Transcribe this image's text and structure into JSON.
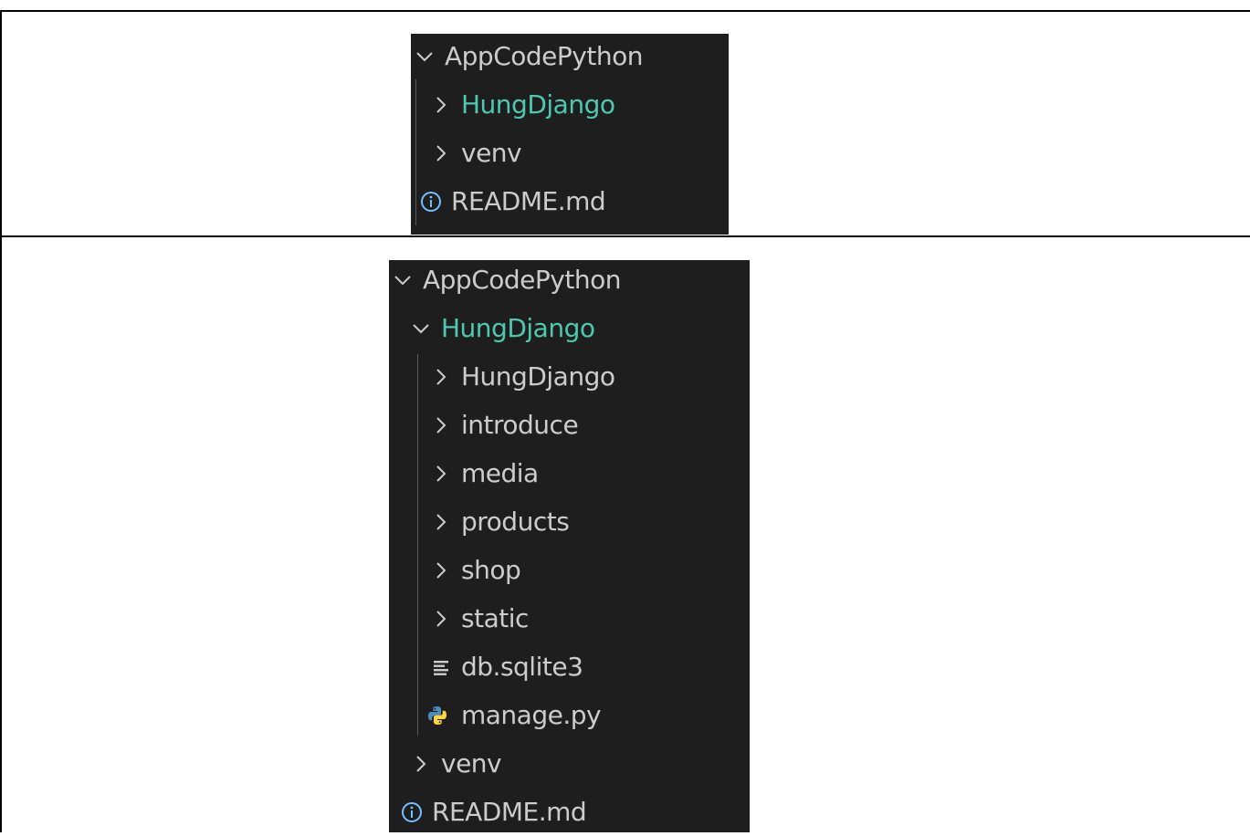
{
  "explorer_collapsed": {
    "root": {
      "label": "AppCodePython",
      "icon": "chevron-down-icon"
    },
    "items": [
      {
        "label": "HungDjango",
        "icon": "chevron-right-icon",
        "active": true
      },
      {
        "label": "venv",
        "icon": "chevron-right-icon"
      },
      {
        "label": "README.md",
        "icon": "info-icon"
      }
    ]
  },
  "explorer_expanded": {
    "root": {
      "label": "AppCodePython",
      "icon": "chevron-down-icon"
    },
    "folder": {
      "label": "HungDjango",
      "icon": "chevron-down-icon",
      "active": true
    },
    "children": [
      {
        "label": "HungDjango",
        "icon": "chevron-right-icon"
      },
      {
        "label": "introduce",
        "icon": "chevron-right-icon"
      },
      {
        "label": "media",
        "icon": "chevron-right-icon"
      },
      {
        "label": "products",
        "icon": "chevron-right-icon"
      },
      {
        "label": "shop",
        "icon": "chevron-right-icon"
      },
      {
        "label": "static",
        "icon": "chevron-right-icon"
      },
      {
        "label": "db.sqlite3",
        "icon": "text-file-icon"
      },
      {
        "label": "manage.py",
        "icon": "python-icon"
      }
    ],
    "items": [
      {
        "label": "venv",
        "icon": "chevron-right-icon"
      },
      {
        "label": "README.md",
        "icon": "info-icon"
      }
    ]
  },
  "colors": {
    "background": "#1e1e1e",
    "text": "#cccccc",
    "active_folder": "#4ec9b0",
    "info_icon": "#75beff",
    "python_blue": "#4b8bbe",
    "python_yellow": "#ffd43b"
  }
}
